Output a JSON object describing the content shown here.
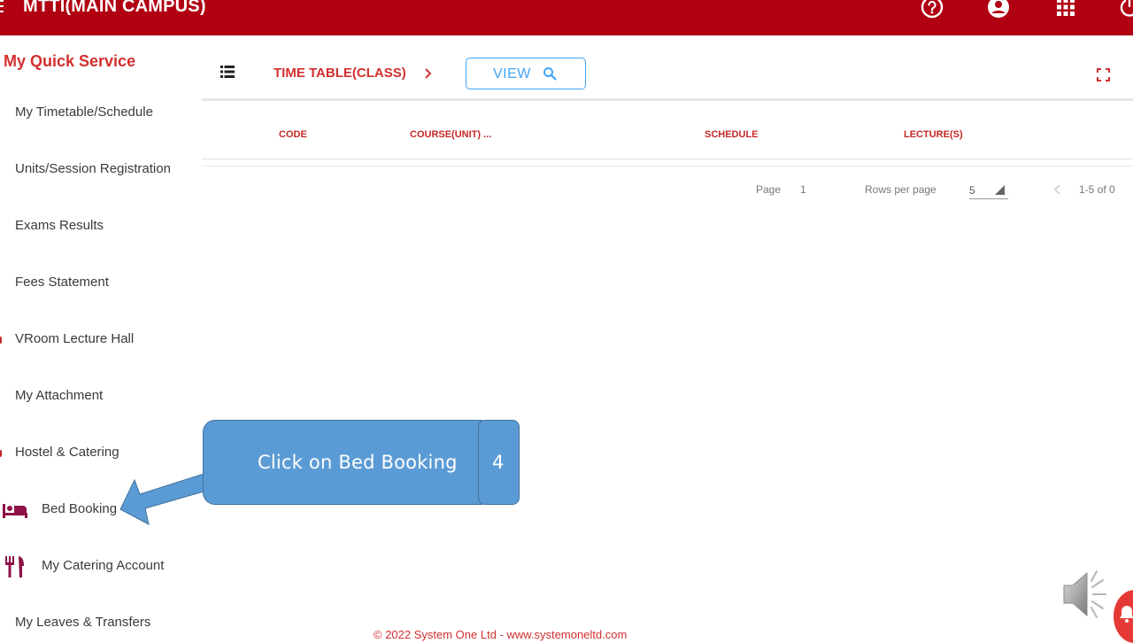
{
  "header": {
    "app_title": "MTTI(MAIN CAMPUS)",
    "icons": [
      "help-icon",
      "account-icon",
      "apps-grid-icon",
      "power-icon"
    ],
    "bar_color": "#b00012"
  },
  "sidebar": {
    "title": "My Quick Service",
    "items": [
      {
        "label": "My Timetable/Schedule"
      },
      {
        "label": "Units/Session Registration"
      },
      {
        "label": "Exams Results"
      },
      {
        "label": "Fees Statement"
      },
      {
        "label": "VRoom Lecture Hall"
      },
      {
        "label": "My Attachment"
      },
      {
        "label": "Hostel & Catering"
      },
      {
        "label": "Bed Booking",
        "icon": "bed-icon"
      },
      {
        "label": "My Catering Account",
        "icon": "restaurant-icon"
      },
      {
        "label": "My Leaves & Transfers"
      }
    ]
  },
  "main": {
    "breadcrumb": "TIME TABLE(CLASS)",
    "view_button": "VIEW",
    "table": {
      "columns": [
        "CODE",
        "COURSE(UNIT) ...",
        "SCHEDULE",
        "LECTURE(S)"
      ],
      "rows": []
    },
    "pagination": {
      "page_label": "Page",
      "page_value": "1",
      "rows_label": "Rows per page",
      "rows_value": "5",
      "range": "1-5 of 0"
    },
    "footer": "© 2022 System One Ltd - www.systemoneltd.com"
  },
  "callout": {
    "text": "Click on Bed Booking",
    "step": "4",
    "color": "#5b9bd5"
  },
  "accent_color": "#d32f2f"
}
